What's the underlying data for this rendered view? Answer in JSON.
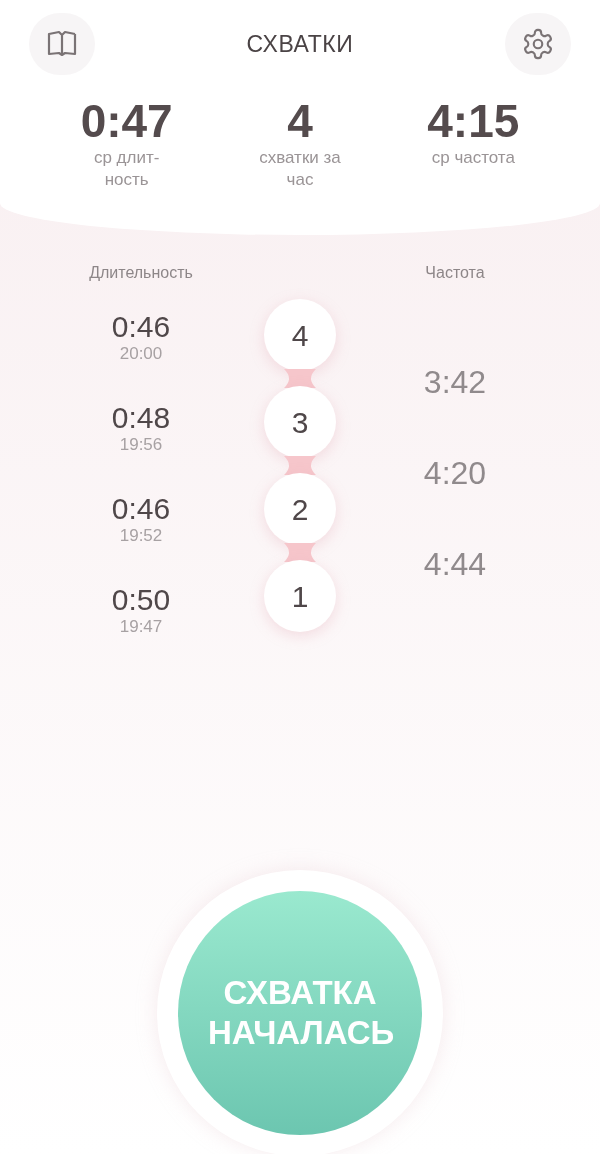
{
  "header": {
    "title": "СХВАТКИ"
  },
  "stats": [
    {
      "value": "0:47",
      "label": "ср длит-ность"
    },
    {
      "value": "4",
      "label": "схватки за час"
    },
    {
      "value": "4:15",
      "label": "ср частота"
    }
  ],
  "columns": {
    "duration": "Длительность",
    "frequency": "Частота"
  },
  "contractions": [
    {
      "number": "4",
      "duration": "0:46",
      "time": "20:00",
      "frequency": "3:42"
    },
    {
      "number": "3",
      "duration": "0:48",
      "time": "19:56",
      "frequency": "4:20"
    },
    {
      "number": "2",
      "duration": "0:46",
      "time": "19:52",
      "frequency": "4:44"
    },
    {
      "number": "1",
      "duration": "0:50",
      "time": "19:47"
    }
  ],
  "start_button": {
    "label": "СХВАТКА НАЧАЛАСЬ"
  }
}
